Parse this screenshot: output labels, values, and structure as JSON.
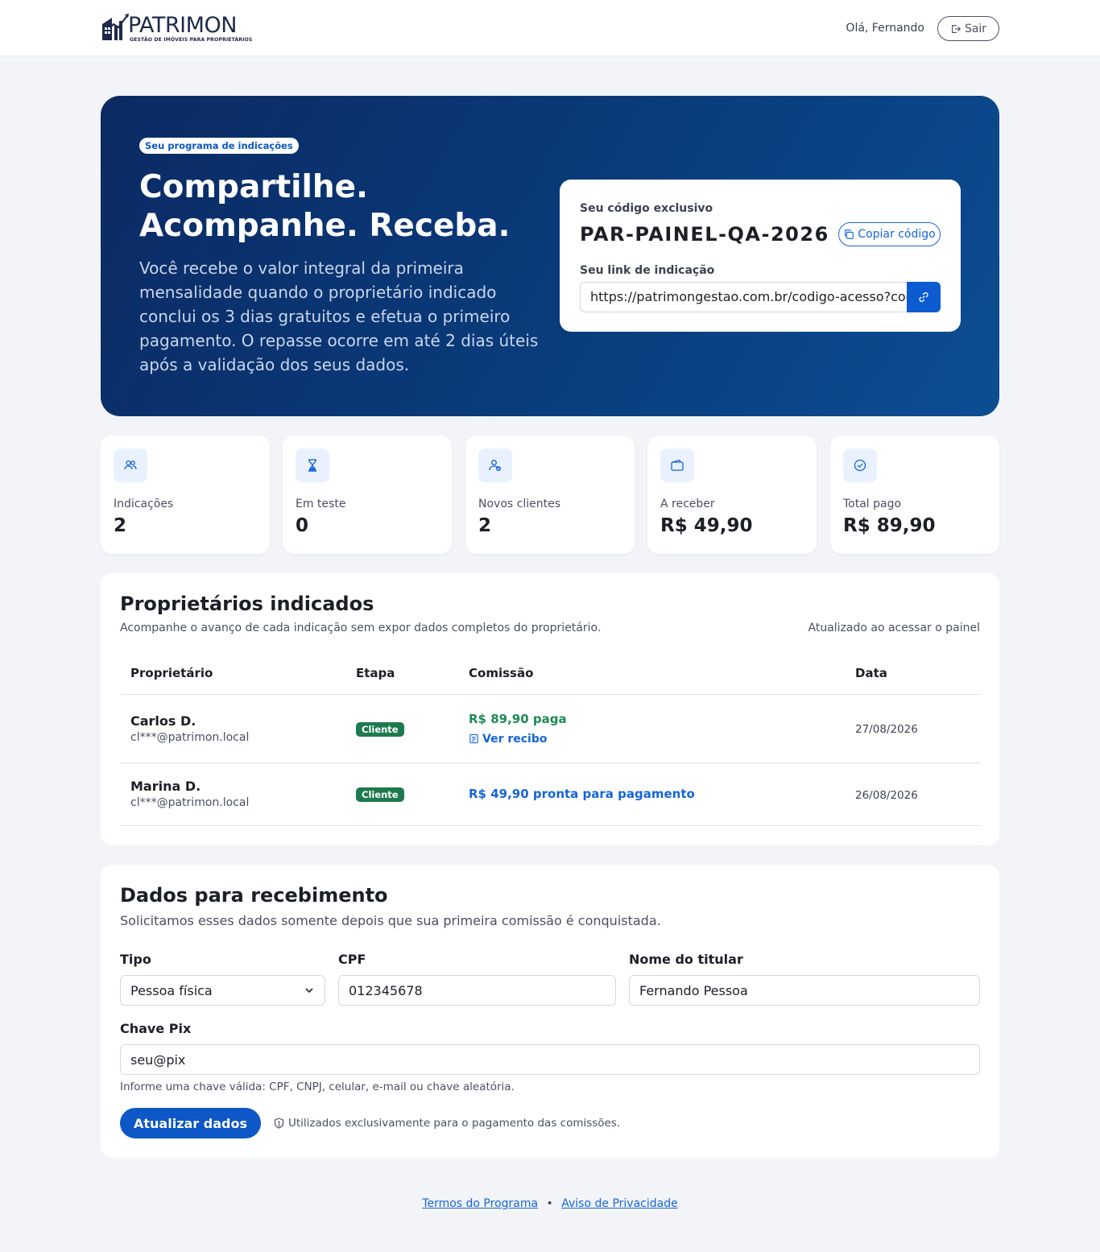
{
  "header": {
    "logo_word": "PATRIMON",
    "logo_tagline": "GESTÃO DE IMÓVEIS PARA PROPRIETÁRIOS",
    "greeting": "Olá, Fernando",
    "logout_label": "Sair"
  },
  "hero": {
    "badge": "Seu programa de indicações",
    "title_line1": "Compartilhe.",
    "title_line2": "Acompanhe. Receba.",
    "description": "Você recebe o valor integral da primeira mensalidade quando o proprietário indicado conclui os 3 dias gratuitos e efetua o primeiro pagamento. O repasse ocorre em até 2 dias úteis após a validação dos seus dados.",
    "code_label": "Seu código exclusivo",
    "code_value": "PAR-PAINEL-QA-2026",
    "copy_label": "Copiar código",
    "link_label": "Seu link de indicação",
    "link_value": "https://patrimongestao.com.br/codigo-acesso?cod"
  },
  "stats": [
    {
      "label": "Indicações",
      "value": "2",
      "icon": "users-icon"
    },
    {
      "label": "Em teste",
      "value": "0",
      "icon": "hourglass-icon"
    },
    {
      "label": "Novos clientes",
      "value": "2",
      "icon": "user-check-icon"
    },
    {
      "label": "A receber",
      "value": "R$ 49,90",
      "icon": "wallet-icon"
    },
    {
      "label": "Total pago",
      "value": "R$ 89,90",
      "icon": "check-circle-icon"
    }
  ],
  "referrals": {
    "title": "Proprietários indicados",
    "subtitle": "Acompanhe o avanço de cada indicação sem expor dados completos do proprietário.",
    "updated": "Atualizado ao acessar o painel",
    "columns": [
      "Proprietário",
      "Etapa",
      "Comissão",
      "Data"
    ],
    "rows": [
      {
        "name": "Carlos D.",
        "email": "cl***@patrimon.local",
        "stage": "Cliente",
        "commission": "R$ 89,90 paga",
        "receipt": "Ver recibo",
        "date": "27/08/2026"
      },
      {
        "name": "Marina D.",
        "email": "cl***@patrimon.local",
        "stage": "Cliente",
        "commission": "R$ 49,90 pronta para pagamento",
        "date": "26/08/2026"
      }
    ]
  },
  "payment": {
    "title": "Dados para recebimento",
    "subtitle": "Solicitamos esses dados somente depois que sua primeira comissão é conquistada.",
    "type_label": "Tipo",
    "type_value": "Pessoa física",
    "cpf_label": "CPF",
    "cpf_value": "012345678",
    "holder_label": "Nome do titular",
    "holder_value": "Fernando Pessoa",
    "pix_label": "Chave Pix",
    "pix_value": "seu@pix",
    "hint": "Informe uma chave válida: CPF, CNPJ, celular, e-mail ou chave aleatória.",
    "submit_label": "Atualizar dados",
    "security_note": "Utilizados exclusivamente para o pagamento das comissões."
  },
  "footer": {
    "terms": "Termos do Programa",
    "separator": "•",
    "privacy": "Aviso de Privacidade"
  },
  "colors": {
    "primary": "#0d57c6",
    "hero_start": "#0b2a63",
    "hero_end": "#0b4e92",
    "success": "#1d8a55",
    "badge_green": "#1d7a4f"
  }
}
